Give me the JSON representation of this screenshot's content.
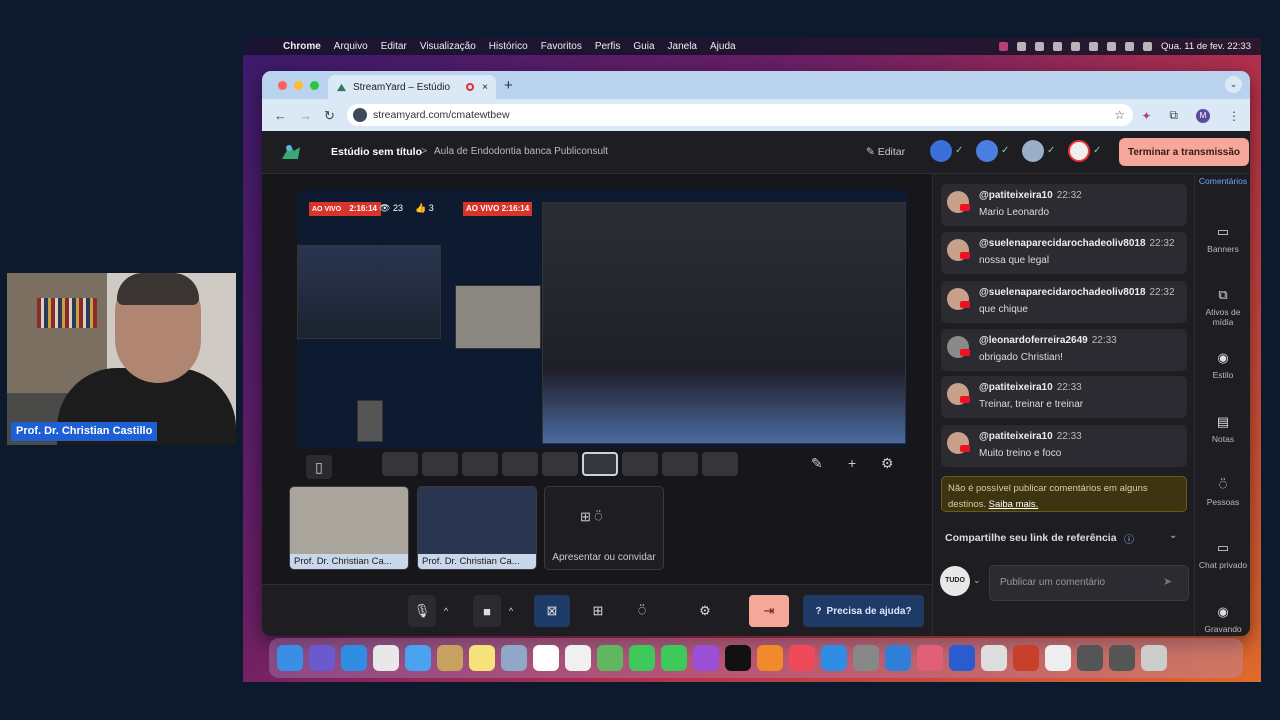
{
  "menubar": {
    "app": "Chrome",
    "items": [
      "Arquivo",
      "Editar",
      "Visualização",
      "Histórico",
      "Favoritos",
      "Perfis",
      "Guia",
      "Janela",
      "Ajuda"
    ],
    "clock": "Qua. 11 de fev.  22:33"
  },
  "browser": {
    "tab_title": "StreamYard – Estúdio",
    "tab_close": "×",
    "new_tab": "+",
    "url": "streamyard.com/cmatewtbew",
    "profile_initial": "M"
  },
  "studio": {
    "title": "Estúdio sem título",
    "breadcrumb_sep": ">",
    "broadcast_title": "Aula de Endodontia banca Publiconsult",
    "edit_label": "Editar",
    "end_button": "Terminar a transmissão"
  },
  "stage": {
    "live_badge_1": "AO VIVO",
    "live_time_1": "2:16:14",
    "viewers_1": "23",
    "likes_1": "3",
    "live_badge_2": "AO VIVO 2:16:14",
    "viewers_2": "23",
    "likes_2": "3"
  },
  "tiles": [
    {
      "label": "Prof. Dr. Christian Ca..."
    },
    {
      "label": "Prof. Dr. Christian Ca..."
    }
  ],
  "invite_label": "Apresentar ou convidar",
  "help_button": "Precisa de ajuda?",
  "comments": [
    {
      "user": "@patiteixeira10",
      "time": "22:32",
      "text": "Mario Leonardo"
    },
    {
      "user": "@suelenaparecidarochadeoliv8018",
      "time": "22:32",
      "text": "nossa que legal"
    },
    {
      "user": "@suelenaparecidarochadeoliv8018",
      "time": "22:32",
      "text": "que chique"
    },
    {
      "user": "@leonardoferreira2649",
      "time": "22:33",
      "text": "obrigado Christian!"
    },
    {
      "user": "@patiteixeira10",
      "time": "22:33",
      "text": "Treinar, treinar e treinar"
    },
    {
      "user": "@patiteixeira10",
      "time": "22:33",
      "text": "Muito treino e foco"
    }
  ],
  "warning": {
    "text": "Não é possível publicar comentários em alguns destinos.",
    "link": "Saiba mais."
  },
  "share_label": "Compartilhe seu link de referência",
  "comment_target": "TUDO",
  "comment_placeholder": "Publicar um comentário",
  "rail": [
    "Comentários",
    "Banners",
    "Ativos de mídia",
    "Estilo",
    "Notas",
    "Pessoas",
    "Chat privado",
    "Gravando"
  ],
  "webcam_label": "Prof. Dr. Christian Castillo",
  "colors": {
    "accent_end": "#f5a89a",
    "live_red": "#d9342b",
    "help_blue": "#1e3a66",
    "cam_label": "#1f5fd4"
  }
}
